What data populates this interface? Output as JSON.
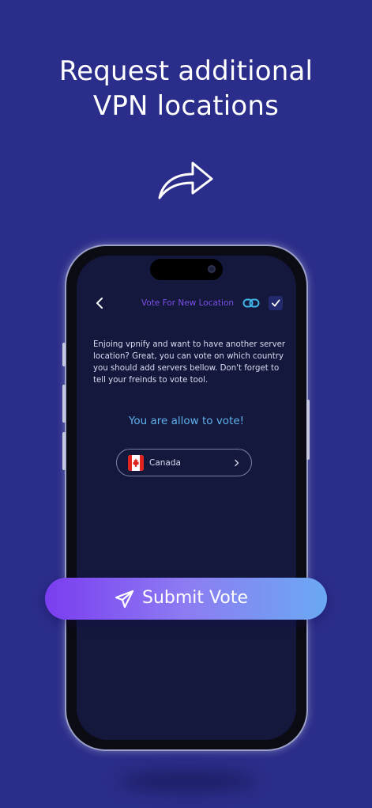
{
  "headline": {
    "line1": "Request additional",
    "line2": "VPN locations"
  },
  "icons": {
    "share": "share-arrow-icon",
    "back": "chevron-left-icon",
    "link": "link-icon",
    "check": "checkmark-icon",
    "flag": "canada-flag-icon",
    "chevron": "chevron-right-icon",
    "send": "paper-plane-icon"
  },
  "app": {
    "title": "Vote For New Location",
    "description": "Enjoing vpnify and want to have another server location? Great, you can vote on which country you should add servers bellow. Don't forget to tell your freinds to vote tool.",
    "status": "You are allow to vote!",
    "selected_country": "Canada"
  },
  "submit": {
    "label": "Submit Vote"
  },
  "colors": {
    "background": "#2b2d8a",
    "screen": "#14183d",
    "title_accent": "#7a4fe6",
    "status_text": "#5fb0ea",
    "link_icon": "#3fb5e8",
    "button_gradient_start": "#7a3df0",
    "button_gradient_end": "#6aa9f3"
  }
}
